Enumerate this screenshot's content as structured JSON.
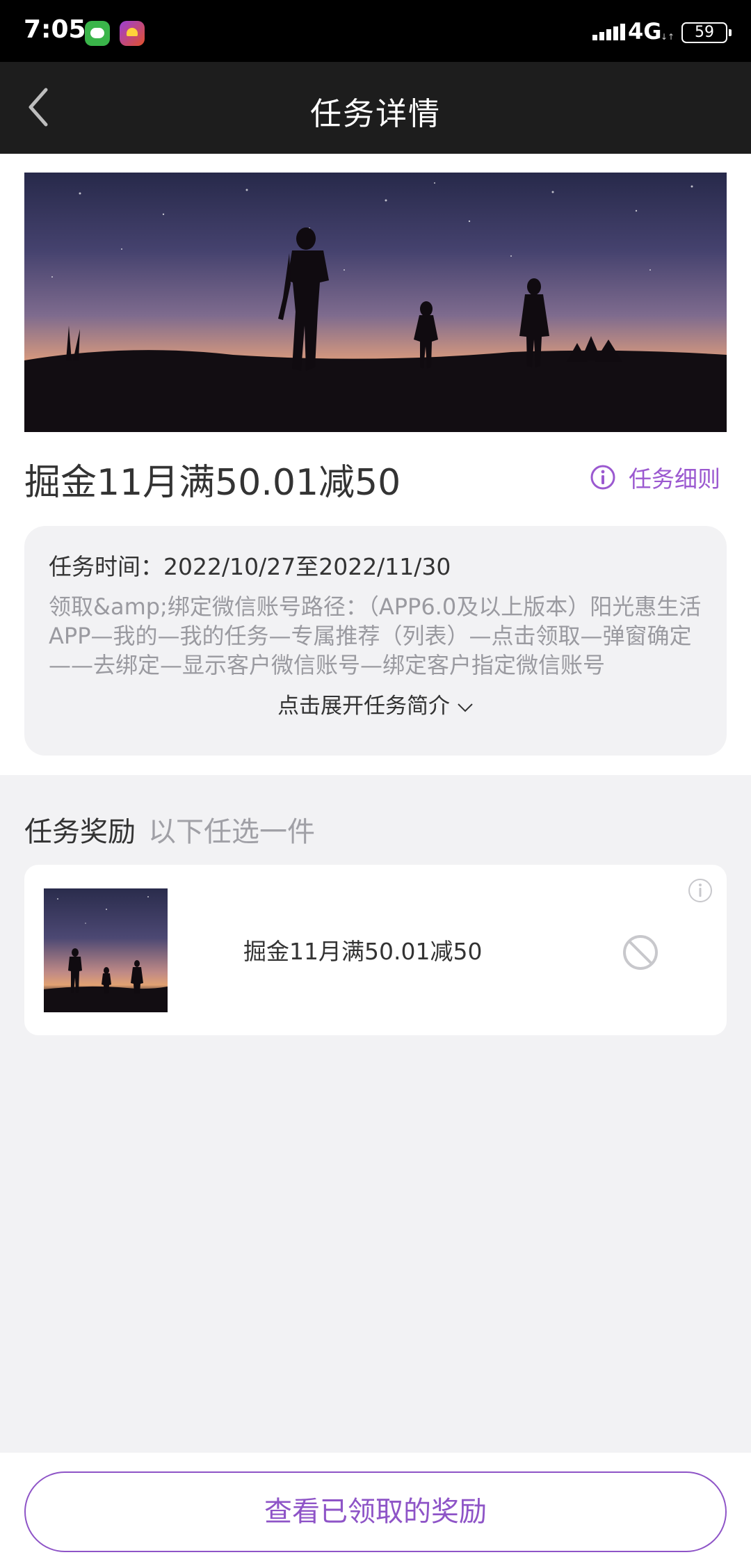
{
  "status_bar": {
    "time": "7:05",
    "network": "4G",
    "battery": "59"
  },
  "nav": {
    "title": "任务详情",
    "back_icon": "chevron-left-icon"
  },
  "task": {
    "title": "掘金11月满50.01减50",
    "rules_link": "任务细则",
    "time_label": "任务时间：",
    "time_value": "2022/10/27至2022/11/30",
    "description": "领取&amp;绑定微信账号路径：（APP6.0及以上版本）阳光惠生活APP—我的—我的任务—专属推荐（列表）—点击领取—弹窗确定——去绑定—显示客户微信账号—绑定客户指定微信账号",
    "expand_label": "点击展开任务简介"
  },
  "rewards": {
    "header": "任务奖励",
    "subheader": "以下任选一件",
    "items": [
      {
        "name": "掘金11月满50.01减50",
        "status_icon": "ban-icon"
      }
    ]
  },
  "bottom": {
    "claimed_button": "查看已领取的奖励"
  },
  "colors": {
    "accent": "#8e54c7",
    "nav_bg": "#1d1d1d",
    "page_bg": "#f2f2f4"
  }
}
